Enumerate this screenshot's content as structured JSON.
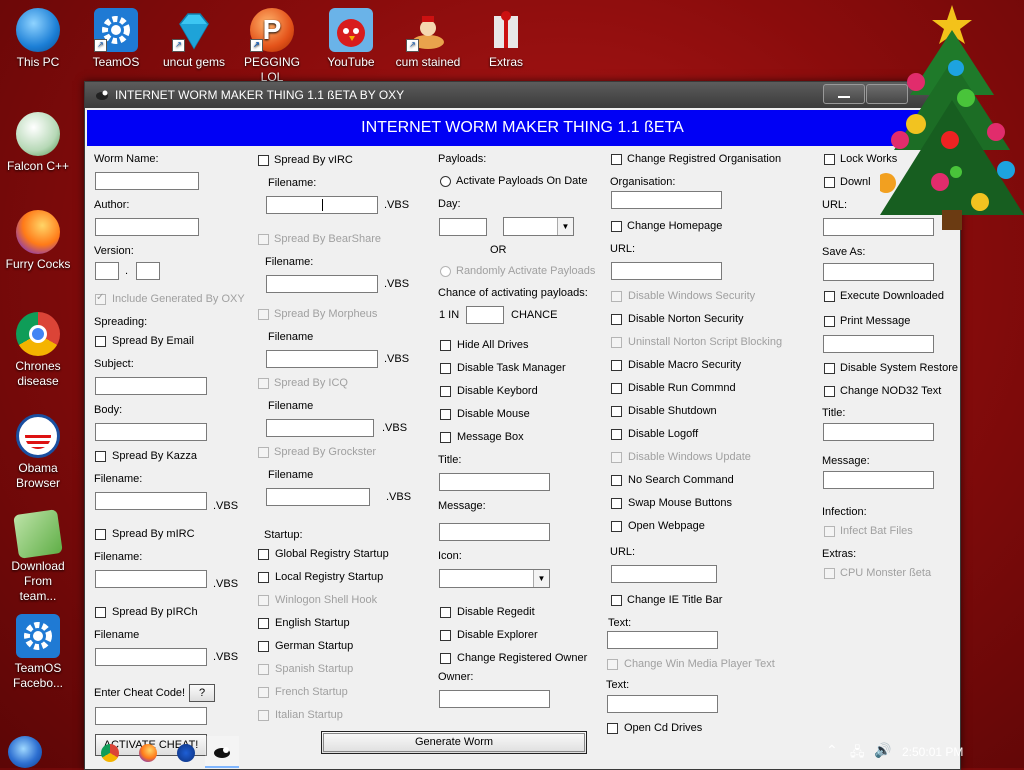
{
  "desktop_icons": [
    {
      "label": "This PC"
    },
    {
      "label": "TeamOS"
    },
    {
      "label": "uncut gems"
    },
    {
      "label": "PEGGING LOL"
    },
    {
      "label": "YouTube"
    },
    {
      "label": "cum stained"
    },
    {
      "label": "Extras"
    },
    {
      "label": "Falcon C++"
    },
    {
      "label": "Furry Cocks"
    },
    {
      "label": "Chrones disease"
    },
    {
      "label": "Obama Browser"
    },
    {
      "label": "Download From team..."
    },
    {
      "label": "TeamOS Facebo..."
    }
  ],
  "window": {
    "title": "INTERNET WORM MAKER THING 1.1 ßETA BY OXY",
    "banner": "INTERNET WORM MAKER THING 1.1 ßETA"
  },
  "col1": {
    "worm_name": "Worm Name:",
    "author": "Author:",
    "version": "Version:",
    "version_dot": ".",
    "include_generated": "Include Generated By OXY",
    "spreading": "Spreading:",
    "spread_email": "Spread By Email",
    "subject": "Subject:",
    "body": "Body:",
    "spread_kazza": "Spread By Kazza",
    "filename_colon": "Filename:",
    "vbs": ".VBS",
    "spread_mirc": "Spread By mIRC",
    "spread_pirch": "Spread By pIRCh",
    "filename": "Filename",
    "enter_cheat": "Enter Cheat Code!",
    "help_btn": "?",
    "activate_cheat": "ACTIVATE CHEAT!"
  },
  "col2": {
    "spread_virc": "Spread By vIRC",
    "filename_colon": "Filename:",
    "vbs": ".VBS",
    "spread_bearshare": "Spread By BearShare",
    "spread_morpheus": "Spread By Morpheus",
    "filename": "Filename",
    "spread_icq": "Spread By ICQ",
    "spread_grockster": "Spread By Grockster",
    "startup": "Startup:",
    "startup_items": [
      {
        "label": "Global Registry Startup",
        "disabled": false
      },
      {
        "label": "Local Registry Startup",
        "disabled": false
      },
      {
        "label": "Winlogon Shell Hook",
        "disabled": true
      },
      {
        "label": "English Startup",
        "disabled": false
      },
      {
        "label": "German Startup",
        "disabled": false
      },
      {
        "label": "Spanish Startup",
        "disabled": true
      },
      {
        "label": "French Startup",
        "disabled": true
      },
      {
        "label": "Italian Startup",
        "disabled": true
      }
    ]
  },
  "col3": {
    "payloads": "Payloads:",
    "activate_on_date": "Activate Payloads On Date",
    "day": "Day:",
    "or": "OR",
    "randomly_activate": "Randomly Activate Payloads",
    "chance": "Chance of activating payloads:",
    "one_in": "1 IN",
    "chance_word": "CHANCE",
    "checks": [
      "Hide All Drives",
      "Disable Task Manager",
      "Disable Keybord",
      "Disable Mouse",
      "Message Box"
    ],
    "title": "Title:",
    "message": "Message:",
    "icon": "Icon:",
    "checks2": [
      "Disable Regedit",
      "Disable Explorer",
      "Change Registered Owner"
    ],
    "owner": "Owner:",
    "generate": "Generate Worm"
  },
  "col4": {
    "change_org": "Change Registred Organisation",
    "organisation": "Organisation:",
    "change_homepage": "Change Homepage",
    "url": "URL:",
    "items": [
      {
        "label": "Disable Windows Security",
        "disabled": true
      },
      {
        "label": "Disable Norton Security",
        "disabled": false
      },
      {
        "label": "Uninstall Norton Script Blocking",
        "disabled": true
      },
      {
        "label": "Disable Macro Security",
        "disabled": false
      },
      {
        "label": "Disable Run Commnd",
        "disabled": false
      },
      {
        "label": "Disable Shutdown",
        "disabled": false
      },
      {
        "label": "Disable Logoff",
        "disabled": false
      },
      {
        "label": "Disable Windows Update",
        "disabled": true
      },
      {
        "label": "No Search Command",
        "disabled": false
      },
      {
        "label": "Swap Mouse Buttons",
        "disabled": false
      },
      {
        "label": "Open Webpage",
        "disabled": false
      }
    ],
    "change_ie": "Change IE Title Bar",
    "text": "Text:",
    "change_wmp": "Change Win Media Player Text",
    "open_cd": "Open Cd Drives"
  },
  "col5": {
    "lock_workstation": "Lock Works",
    "download": "Downl",
    "url": "URL:",
    "save_as": "Save As:",
    "execute_downloaded": "Execute Downloaded",
    "print_message": "Print Message",
    "disable_system_restore": "Disable System Restore",
    "change_nod32": "Change NOD32 Text",
    "title": "Title:",
    "message": "Message:",
    "infection": "Infection:",
    "infect_bat": "Infect Bat Files",
    "extras": "Extras:",
    "cpu_monster": "CPU Monster ßeta"
  },
  "taskbar": {
    "clock": "2:50:01 PM"
  },
  "colors": {
    "banner": "#0000f5",
    "desktop": "#8a0c0c",
    "disabled_text": "#a0a0a0"
  }
}
